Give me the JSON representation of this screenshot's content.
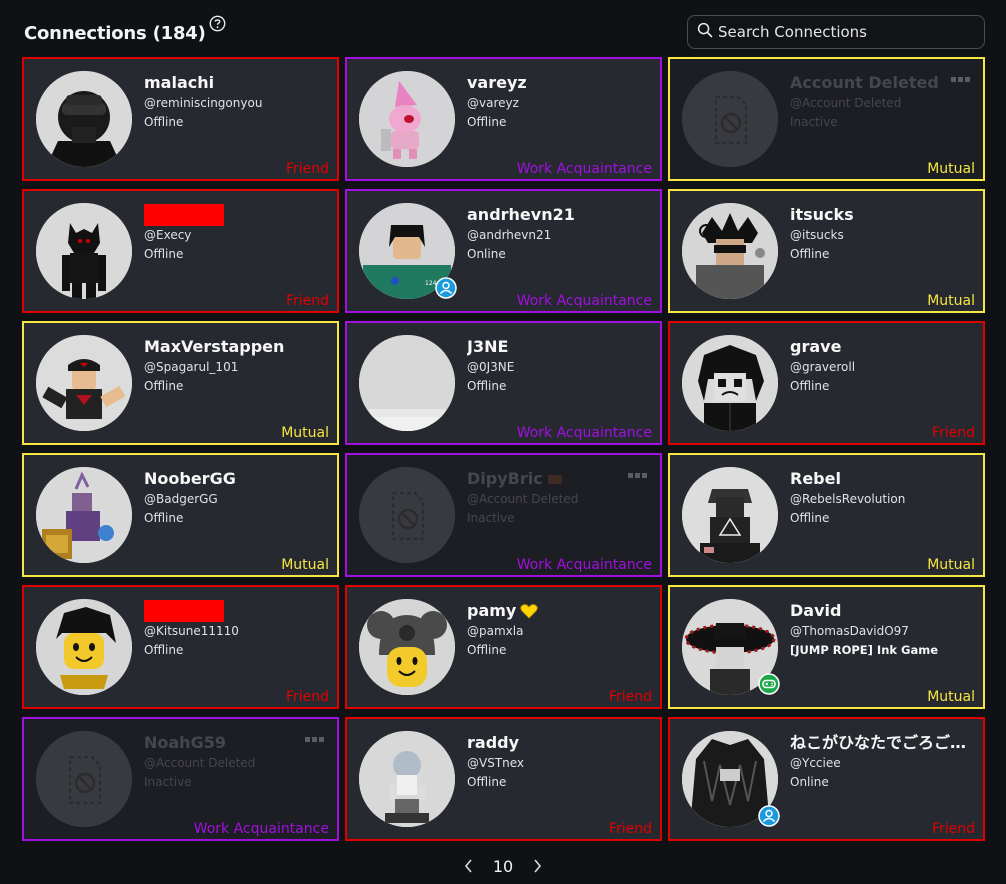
{
  "header": {
    "title": "Connections (184)"
  },
  "search": {
    "placeholder": "Search Connections"
  },
  "pagination": {
    "page": "10"
  },
  "colors": {
    "friend": "#e00000",
    "mutual": "#f5e642",
    "work": "#a010e0",
    "online": "#1a9be0",
    "ingame": "#1fa84a",
    "redaction": "#ff0000"
  },
  "cards": [
    {
      "name": "malachi",
      "username": "@reminiscingonyou",
      "status": "Offline",
      "tag": "Friend",
      "kind": "friend",
      "avatar": "malachi"
    },
    {
      "name": "vareyz",
      "username": "@vareyz",
      "status": "Offline",
      "tag": "Work Acquaintance",
      "kind": "work",
      "avatar": "vareyz"
    },
    {
      "name": "Account Deleted",
      "username": "@Account Deleted",
      "status": "Inactive",
      "tag": "Mutual",
      "kind": "mutual",
      "avatar": "deleted",
      "deleted": true
    },
    {
      "name": "",
      "redacted": true,
      "username": "@Execy",
      "status": "Offline",
      "tag": "Friend",
      "kind": "friend",
      "avatar": "execy"
    },
    {
      "name": "andrhevn21",
      "username": "@andrhevn21",
      "status": "Online",
      "tag": "Work Acquaintance",
      "kind": "work",
      "avatar": "andrhevn",
      "presence": "online"
    },
    {
      "name": "itsucks",
      "username": "@itsucks",
      "status": "Offline",
      "tag": "Mutual",
      "kind": "mutual",
      "avatar": "itsucks"
    },
    {
      "name": "MaxVerstappen",
      "username": "@Spagarul_101",
      "status": "Offline",
      "tag": "Mutual",
      "kind": "mutual",
      "avatar": "max"
    },
    {
      "name": "J3NE",
      "username": "@0J3NE",
      "status": "Offline",
      "tag": "Work Acquaintance",
      "kind": "work",
      "avatar": "j3ne"
    },
    {
      "name": "grave",
      "username": "@graveroll",
      "status": "Offline",
      "tag": "Friend",
      "kind": "friend",
      "avatar": "grave"
    },
    {
      "name": "NooberGG",
      "username": "@BadgerGG",
      "status": "Offline",
      "tag": "Mutual",
      "kind": "mutual",
      "avatar": "noober"
    },
    {
      "name": "DipyBric",
      "username": "@Account Deleted",
      "status": "Inactive",
      "tag": "Work Acquaintance",
      "kind": "work",
      "avatar": "deleted",
      "deleted": true,
      "emoji": "brick"
    },
    {
      "name": "Rebel",
      "username": "@RebelsRevolution",
      "status": "Offline",
      "tag": "Mutual",
      "kind": "mutual",
      "avatar": "rebel"
    },
    {
      "name": "",
      "redacted": true,
      "username": "@Kitsune11110",
      "status": "Offline",
      "tag": "Friend",
      "kind": "friend",
      "avatar": "kitsune"
    },
    {
      "name": "pamy",
      "username": "@pamxla",
      "status": "Offline",
      "tag": "Friend",
      "kind": "friend",
      "avatar": "pamy",
      "emoji": "heart"
    },
    {
      "name": "David",
      "username": "@ThomasDavidO97",
      "status": "[JUMP ROPE] Ink Game",
      "tag": "Mutual",
      "kind": "mutual",
      "avatar": "david",
      "presence": "ingame",
      "game": true
    },
    {
      "name": "NoahG59",
      "username": "@Account Deleted",
      "status": "Inactive",
      "tag": "Work Acquaintance",
      "kind": "work",
      "avatar": "deleted",
      "deleted": true
    },
    {
      "name": "raddy",
      "username": "@VSTnex",
      "status": "Offline",
      "tag": "Friend",
      "kind": "friend",
      "avatar": "raddy"
    },
    {
      "name": "ねこがひなたでごろご…",
      "username": "@Ycciee",
      "status": "Online",
      "tag": "Friend",
      "kind": "friend",
      "avatar": "neko",
      "presence": "online"
    }
  ]
}
